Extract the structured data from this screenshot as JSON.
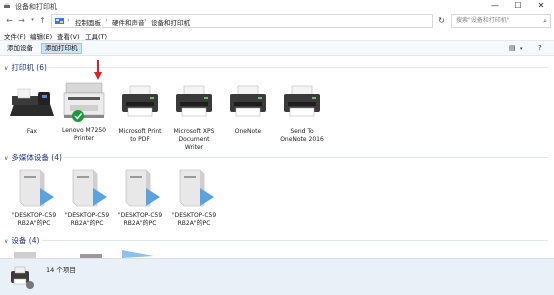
{
  "window": {
    "title": "设备和打印机",
    "minimize": "—",
    "maximize": "☐",
    "close": "✕"
  },
  "nav": {
    "back": "←",
    "forward": "→",
    "up": "↑",
    "breadcrumb": [
      "控制面板",
      "硬件和声音",
      "设备和打印机"
    ],
    "search_placeholder": "搜索\"设备和打印机\""
  },
  "menu": [
    "文件(F)",
    "编辑(E)",
    "查看(V)",
    "工具(T)"
  ],
  "commands": {
    "add_device": "添加设备",
    "add_printer": "添加打印机"
  },
  "groups": {
    "printers": {
      "label": "打印机 (6)"
    },
    "multimedia": {
      "label": "多媒体设备 (4)"
    },
    "devices": {
      "label": "设备 (4)"
    }
  },
  "printers": [
    {
      "label": "Fax",
      "icon": "fax-icon"
    },
    {
      "label": "Lenovo M7250\nPrinter",
      "icon": "multifunction-printer-icon",
      "default": true
    },
    {
      "label": "Microsoft Print\nto PDF",
      "icon": "printer-icon"
    },
    {
      "label": "Microsoft XPS\nDocument\nWriter",
      "icon": "printer-icon"
    },
    {
      "label": "OneNote",
      "icon": "printer-icon"
    },
    {
      "label": "Send To\nOneNote 2016",
      "icon": "printer-icon"
    }
  ],
  "multimedia": [
    {
      "label": "\"DESKTOP-C59\nRB2A\"的PC",
      "icon": "media-pc-icon"
    },
    {
      "label": "\"DESKTOP-C59\nRB2A\"的PC",
      "icon": "media-pc-icon"
    },
    {
      "label": "\"DESKTOP-C59\nRB2A\"的PC",
      "icon": "media-pc-icon"
    },
    {
      "label": "\"DESKTOP-C59\nRB2A\"的PC",
      "icon": "media-pc-icon"
    }
  ],
  "status": {
    "count": "14 个项目"
  },
  "colors": {
    "group_header": "#1e3287",
    "cmdbar_bg": "#f5f8fc",
    "status_bg": "#eaf0f8",
    "default_check": "#1a9b3a",
    "arrow": "#e02020"
  }
}
